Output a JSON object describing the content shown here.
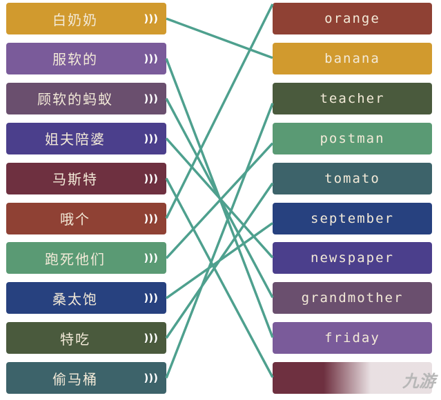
{
  "line_color": "#4ea08e",
  "left_items": [
    {
      "label": "白奶奶",
      "color": "#d19a2e",
      "match": 1
    },
    {
      "label": "服软的",
      "color": "#7a5b9a",
      "match": 8
    },
    {
      "label": "顾软的蚂蚁",
      "color": "#6a4f6e",
      "match": 7
    },
    {
      "label": "姐夫陪婆",
      "color": "#4b3f8c",
      "match": 6
    },
    {
      "label": "马斯特",
      "color": "#6e3040",
      "match": 9
    },
    {
      "label": "哦个",
      "color": "#8f4134",
      "match": 0
    },
    {
      "label": "跑死他们",
      "color": "#5a9a74",
      "match": 3
    },
    {
      "label": "桑太饱",
      "color": "#27417f",
      "match": 5
    },
    {
      "label": "特吃",
      "color": "#4a5a3d",
      "match": 4
    },
    {
      "label": "偷马桶",
      "color": "#3d636a",
      "match": 2
    }
  ],
  "speaker_icon": "sound-wave-icon",
  "speaker_glyph": "))) ",
  "right_items": [
    {
      "label": "orange",
      "color": "#8f4134"
    },
    {
      "label": "banana",
      "color": "#d19a2e"
    },
    {
      "label": "teacher",
      "color": "#4a5a3d"
    },
    {
      "label": "postman",
      "color": "#5a9a74"
    },
    {
      "label": "tomato",
      "color": "#3d636a"
    },
    {
      "label": "september",
      "color": "#27417f"
    },
    {
      "label": "newspaper",
      "color": "#4b3f8c"
    },
    {
      "label": "grandmother",
      "color": "#6a4f6e"
    },
    {
      "label": "friday",
      "color": "#7a5b9a"
    },
    {
      "label": "",
      "color": "#6e3040"
    }
  ],
  "watermark": "九游"
}
